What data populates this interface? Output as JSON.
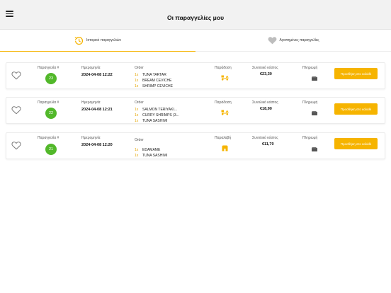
{
  "header": {
    "title": "Οι παραγγελίες μου"
  },
  "tabs": [
    {
      "label": "Ιστορικό παραγγελιών",
      "icon": "clock-history-icon",
      "active": true
    },
    {
      "label": "Αγαπημένες παραγγελίες",
      "icon": "heart-icon",
      "active": false
    }
  ],
  "columns": {
    "order_no": "Παραγγελία #",
    "date": "Ημερομηνία",
    "order": "Order",
    "delivery": "Παράδοση",
    "total": "Συνολικό κόστος",
    "payment": "Πληρωμή"
  },
  "orders": [
    {
      "number": "23",
      "date": "2024-04-08 12:22",
      "delivery_label": "Παράδοση",
      "delivery_icon": "delivery-scooter-icon",
      "items": [
        {
          "qty": "1x",
          "name": "TUNA TARTAR"
        },
        {
          "qty": "1x",
          "name": "BREAM CEVICHE"
        },
        {
          "qty": "1x",
          "name": "SHRIMP CEVICHE"
        }
      ],
      "total": "€23,30",
      "payment_icon": "wallet-icon",
      "button": "Προσθήκη στο καλάθι"
    },
    {
      "number": "22",
      "date": "2024-04-08 12:21",
      "delivery_label": "Παράδοση",
      "delivery_icon": "delivery-scooter-icon",
      "items": [
        {
          "qty": "1x",
          "name": "SALMON TERIYAKI..."
        },
        {
          "qty": "1x",
          "name": "CURRY SHRIMPS (3..."
        },
        {
          "qty": "1x",
          "name": "TUNA SASHIMI"
        }
      ],
      "total": "€18,90",
      "payment_icon": "wallet-icon",
      "button": "Προσθήκη στο καλάθι"
    },
    {
      "number": "21",
      "date": "2024-04-08 12:20",
      "delivery_label": "Παραλαβή",
      "delivery_icon": "store-pickup-icon",
      "items": [
        {
          "qty": "1x",
          "name": "EDAMAME"
        },
        {
          "qty": "1x",
          "name": "TUNA SASHIMI"
        }
      ],
      "total": "€11,70",
      "payment_icon": "wallet-icon",
      "button": "Προσθήκη στο καλάθι"
    }
  ],
  "colors": {
    "accent": "#f6b400",
    "badge": "#52b82a",
    "background": "#ffffff",
    "topbar": "#f2f2f2"
  }
}
